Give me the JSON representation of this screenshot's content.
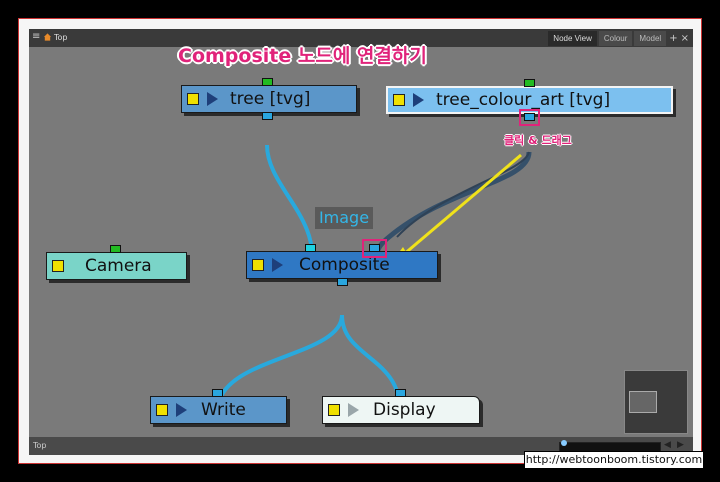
{
  "window": {
    "breadcrumb": "Top",
    "tabs": [
      {
        "label": "Node View",
        "active": true
      },
      {
        "label": "Colour",
        "active": false
      },
      {
        "label": "Model",
        "active": false
      }
    ],
    "add_symbol": "+",
    "close_symbol": "×",
    "bottom_breadcrumb": "Top"
  },
  "annotation": {
    "title": "Composite 노드에 연결하기",
    "drag_note": "클릭 & 드래그",
    "image_port_label": "Image"
  },
  "nodes": {
    "tree": "tree  [tvg]",
    "tree_colour_art": "tree_colour_art  [tvg]",
    "camera": "Camera",
    "composite": "Composite",
    "write": "Write",
    "display": "Display"
  },
  "colors": {
    "accent": "#e0237a",
    "node_blue": "#5b96c9",
    "node_selected": "#7cc0ef",
    "composite_node": "#2f78c4",
    "camera_node": "#7ad4c8",
    "display_node": "#eef6f4",
    "connection": "#29a9dd",
    "dragged_connection": "#35506a",
    "arrow": "#f0e21a"
  },
  "watermark": "http://webtoonboom.tistory.com"
}
